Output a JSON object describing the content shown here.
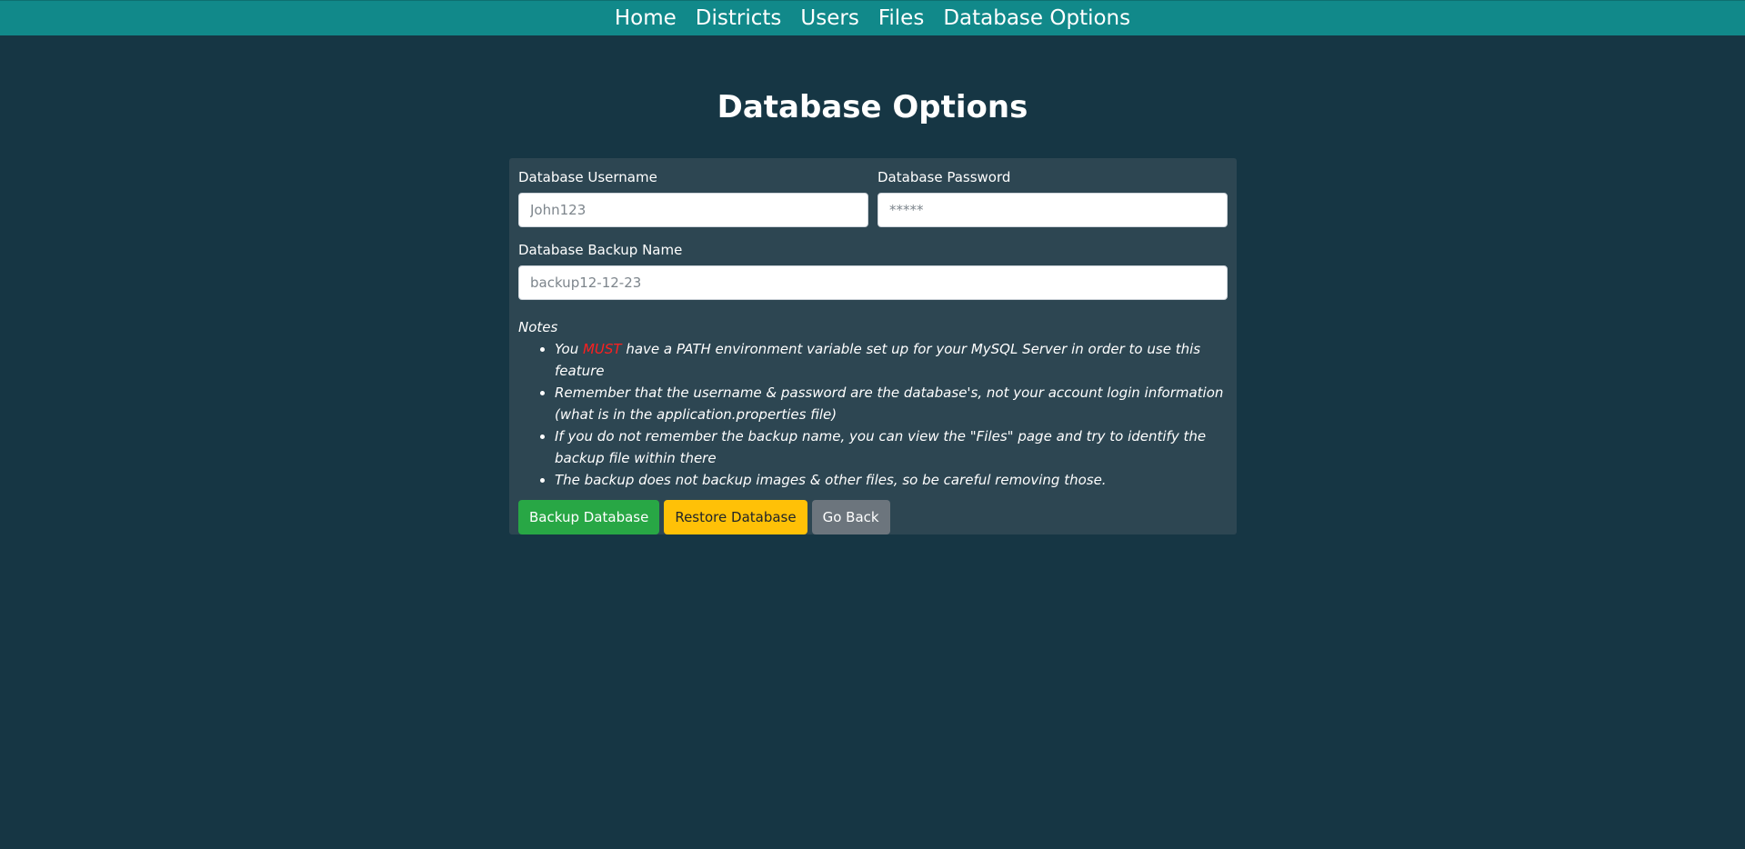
{
  "nav": {
    "items": [
      {
        "label": "Home"
      },
      {
        "label": "Districts"
      },
      {
        "label": "Users"
      },
      {
        "label": "Files"
      },
      {
        "label": "Database Options"
      }
    ]
  },
  "page": {
    "title": "Database Options"
  },
  "form": {
    "username_label": "Database Username",
    "username_placeholder": "John123",
    "password_label": "Database Password",
    "password_placeholder": "*****",
    "backup_label": "Database Backup Name",
    "backup_placeholder": "backup12-12-23"
  },
  "notes": {
    "title": "Notes",
    "note1_prefix": "You ",
    "note1_emphasis": "MUST",
    "note1_suffix": " have a PATH environment variable set up for your MySQL Server in order to use this feature",
    "note2": "Remember that the username & password are the database's, not your account login information (what is in the application.properties file)",
    "note3": "If you do not remember the backup name, you can view the \"Files\" page and try to identify the backup file within there",
    "note4": "The backup does not backup images & other files, so be careful removing those."
  },
  "buttons": {
    "backup": "Backup Database",
    "restore": "Restore Database",
    "back": "Go Back"
  },
  "colors": {
    "background": "#163644",
    "navbar": "#11898a",
    "card": "#2d4652",
    "must": "#ff1f1f",
    "success": "#28a745",
    "warning": "#ffc107",
    "secondary": "#6c757d"
  }
}
